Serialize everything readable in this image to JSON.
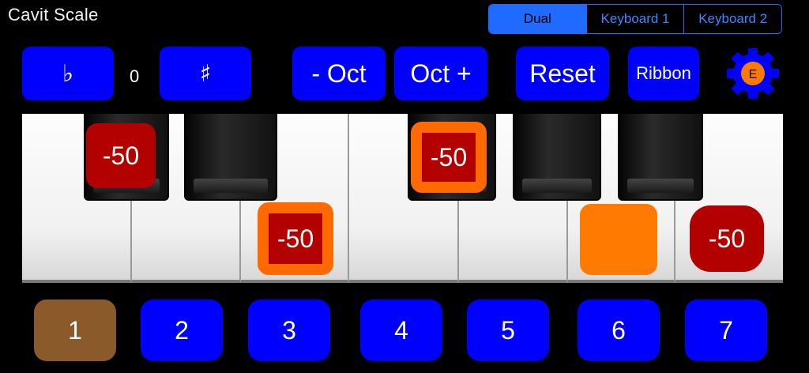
{
  "app": {
    "title": "Cavit Scale"
  },
  "mode_tabs": [
    {
      "label": "Dual",
      "active": true
    },
    {
      "label": "Keyboard 1",
      "active": false
    },
    {
      "label": "Keyboard 2",
      "active": false
    }
  ],
  "controls": {
    "flat_label": "♭",
    "transpose_value": "0",
    "sharp_label": "♯",
    "oct_minus_label": "- Oct",
    "oct_plus_label": "Oct +",
    "reset_label": "Reset",
    "ribbon_label": "Ribbon",
    "settings_badge": "E"
  },
  "keyboard": {
    "markers": [
      {
        "label": "-50",
        "style": "red"
      },
      {
        "label": "-50",
        "style": "orange-red"
      },
      {
        "label": "-50",
        "style": "orange-red"
      },
      {
        "label": "",
        "style": "orange"
      },
      {
        "label": "-50",
        "style": "red"
      }
    ]
  },
  "degrees": [
    {
      "label": "1",
      "active": true
    },
    {
      "label": "2",
      "active": false
    },
    {
      "label": "3",
      "active": false
    },
    {
      "label": "4",
      "active": false
    },
    {
      "label": "5",
      "active": false
    },
    {
      "label": "6",
      "active": false
    },
    {
      "label": "7",
      "active": false
    }
  ],
  "colors": {
    "accent": "#0000ff",
    "segment": "#1f6bff",
    "marker_red": "#b30000",
    "marker_orange": "#ff7a00",
    "degree_active": "#8b5a2b"
  }
}
